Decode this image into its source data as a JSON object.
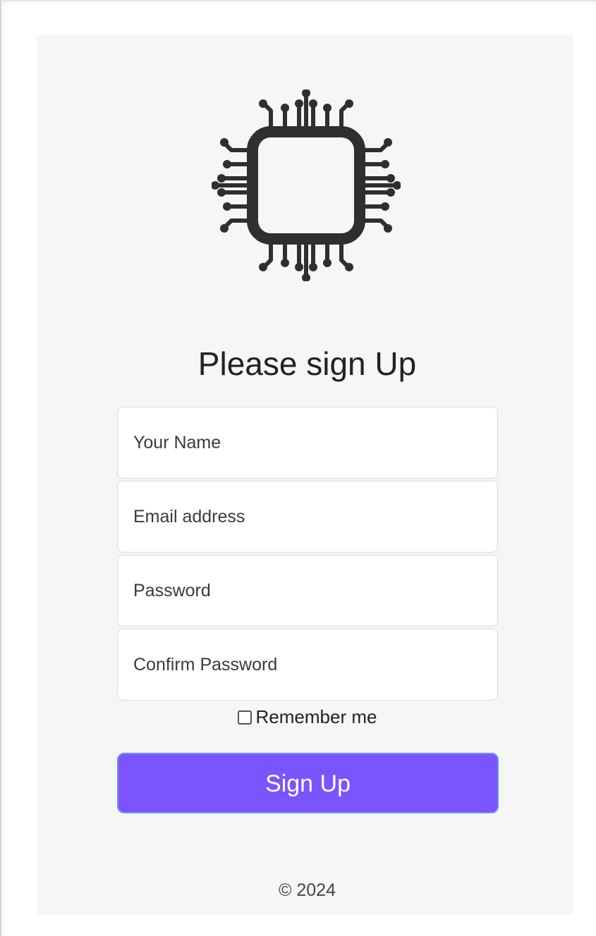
{
  "form": {
    "title": "Please sign Up",
    "fields": [
      {
        "name": "name",
        "placeholder": "Your Name"
      },
      {
        "name": "email",
        "placeholder": "Email address"
      },
      {
        "name": "password",
        "placeholder": "Password"
      },
      {
        "name": "confirm",
        "placeholder": "Confirm Password"
      }
    ],
    "remember_label": "Remember me",
    "remember_checked": false,
    "submit_label": "Sign Up"
  },
  "footer": {
    "copyright": "© 2024"
  },
  "logo": {
    "icon": "microchip-icon",
    "color": "#2f2f2f"
  },
  "colors": {
    "accent": "#7c54fd",
    "panel": "#f6f6f6"
  }
}
